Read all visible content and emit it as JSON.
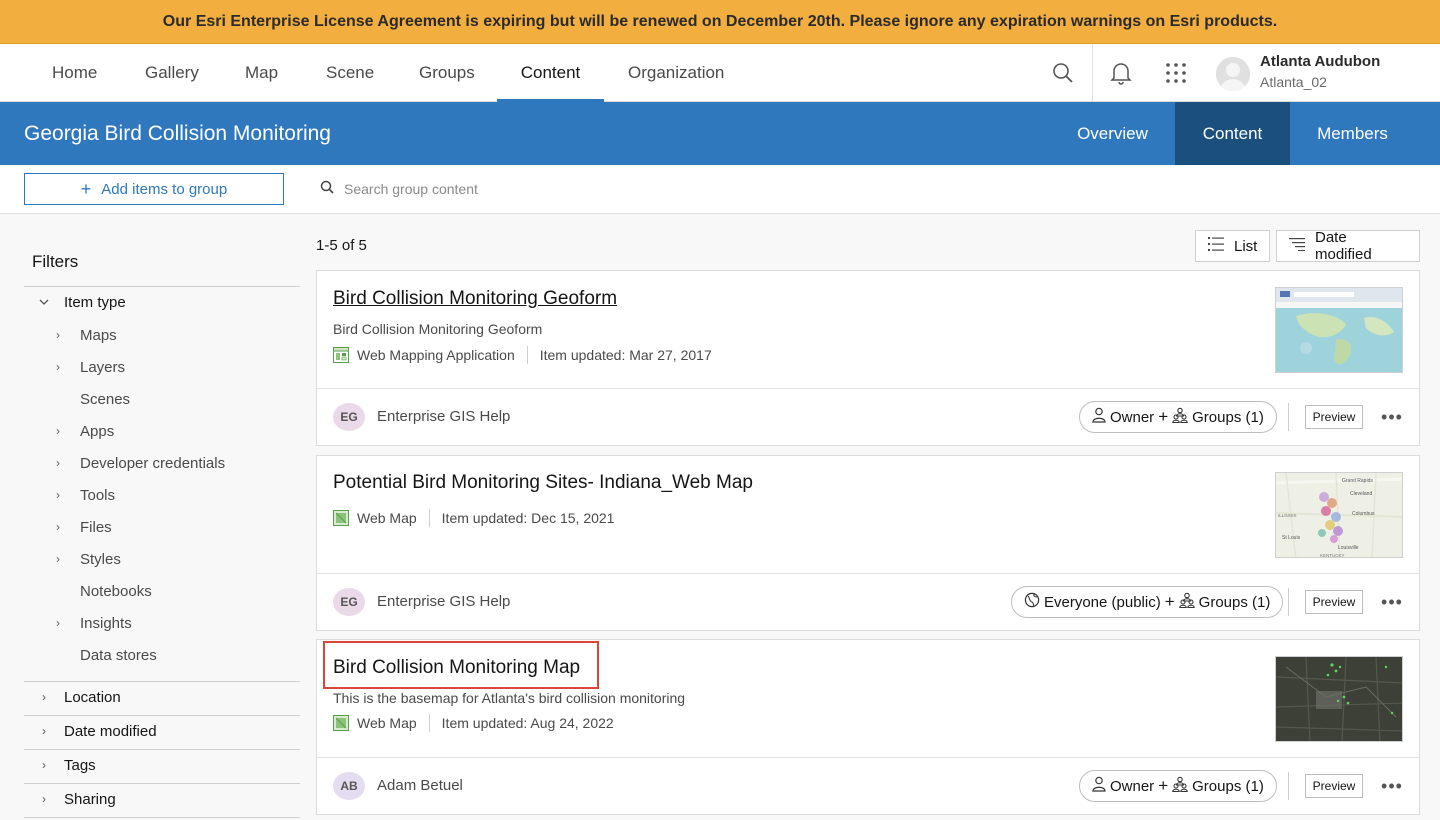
{
  "banner": {
    "text": "Our Esri Enterprise License Agreement is expiring but will be renewed on December 20th. Please ignore any expiration warnings on Esri products."
  },
  "topnav": {
    "items": [
      {
        "label": "Home",
        "active": false
      },
      {
        "label": "Gallery",
        "active": false
      },
      {
        "label": "Map",
        "active": false
      },
      {
        "label": "Scene",
        "active": false
      },
      {
        "label": "Groups",
        "active": false
      },
      {
        "label": "Content",
        "active": true
      },
      {
        "label": "Organization",
        "active": false
      }
    ],
    "icons": [
      "search-icon",
      "bell-icon",
      "app-launcher-icon"
    ],
    "user": {
      "name": "Atlanta Audubon",
      "username": "Atlanta_02"
    }
  },
  "group": {
    "title": "Georgia Bird Collision Monitoring",
    "tabs": [
      {
        "label": "Overview",
        "active": false
      },
      {
        "label": "Content",
        "active": true
      },
      {
        "label": "Members",
        "active": false
      }
    ]
  },
  "toolbar": {
    "add_label": "Add items to group",
    "search_placeholder": "Search group content"
  },
  "filters": {
    "title": "Filters",
    "item_type": {
      "label": "Item type",
      "sub": [
        {
          "label": "Maps",
          "expandable": true
        },
        {
          "label": "Layers",
          "expandable": true
        },
        {
          "label": "Scenes",
          "expandable": false
        },
        {
          "label": "Apps",
          "expandable": true
        },
        {
          "label": "Developer credentials",
          "expandable": true
        },
        {
          "label": "Tools",
          "expandable": true
        },
        {
          "label": "Files",
          "expandable": true
        },
        {
          "label": "Styles",
          "expandable": true
        },
        {
          "label": "Notebooks",
          "expandable": false
        },
        {
          "label": "Insights",
          "expandable": true
        },
        {
          "label": "Data stores",
          "expandable": false
        }
      ]
    },
    "sections": [
      "Location",
      "Date modified",
      "Tags",
      "Sharing"
    ]
  },
  "results": {
    "count": "1-5 of 5",
    "view_label": "List",
    "sort_label": "Date modified",
    "preview_label": "Preview",
    "items": [
      {
        "title": "Bird Collision Monitoring Geoform",
        "description": "Bird Collision Monitoring Geoform",
        "type": "Web Mapping Application",
        "updated": "Item updated: Mar 27, 2017",
        "owner_initials": "EG",
        "owner_name": "Enterprise GIS Help",
        "share_primary": "Owner",
        "share_groups": "Groups (1)",
        "badge_color": "#ead9e8"
      },
      {
        "title": "Potential Bird Monitoring Sites- Indiana_Web Map",
        "description": "",
        "type": "Web Map",
        "updated": "Item updated: Dec 15, 2021",
        "owner_initials": "EG",
        "owner_name": "Enterprise GIS Help",
        "share_primary": "Everyone (public)",
        "share_groups": "Groups (1)",
        "badge_color": "#ead9e8"
      },
      {
        "title": "Bird Collision Monitoring Map",
        "description": "This is the basemap for Atlanta's bird collision monitoring",
        "type": "Web Map",
        "updated": "Item updated: Aug 24, 2022",
        "owner_initials": "AB",
        "owner_name": "Adam Betuel",
        "share_primary": "Owner",
        "share_groups": "Groups (1)",
        "badge_color": "#e4dcef"
      }
    ],
    "thumb_labels": {
      "grand_rapids": "Grand Rapids",
      "cleveland": "Cleveland",
      "columbus": "Columbus",
      "illinois": "ILLINOIS",
      "st_louis": "St Louis",
      "louisville": "Louisville",
      "kentucky": "KENTUCKY"
    }
  }
}
